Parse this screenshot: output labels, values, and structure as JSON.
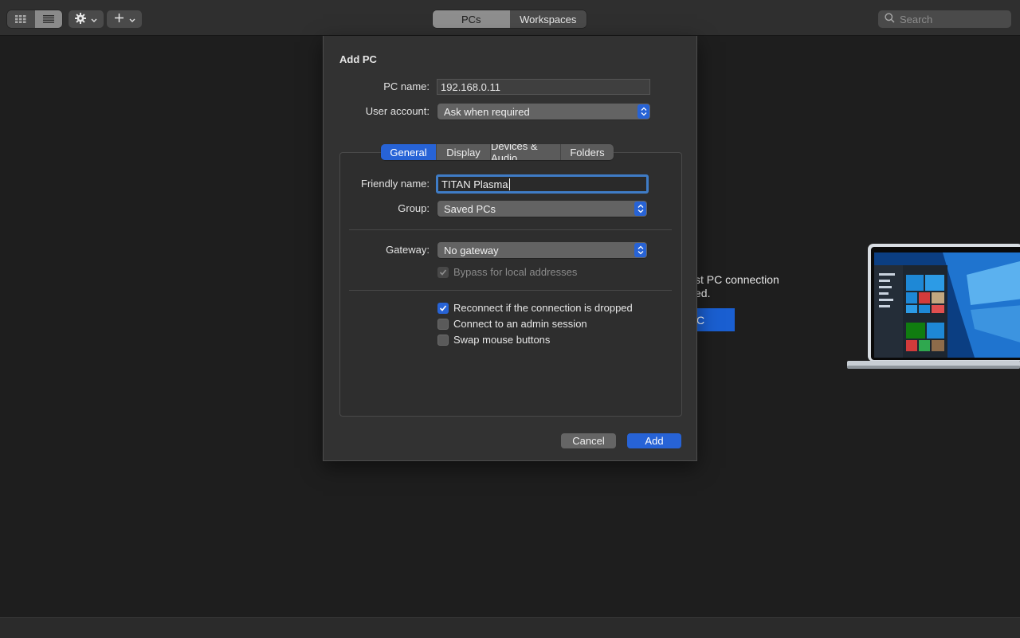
{
  "toolbar": {
    "view_buttons": [
      {
        "icon": "grid-icon",
        "selected": false
      },
      {
        "icon": "list-icon",
        "selected": true
      }
    ],
    "settings_icon": "gear-icon",
    "add_icon": "plus-icon",
    "segments": [
      {
        "label": "PCs",
        "selected": true
      },
      {
        "label": "Workspaces",
        "selected": false
      }
    ],
    "search_placeholder": "Search"
  },
  "background": {
    "empty_line1": "st PC connection",
    "empty_line2": "ed.",
    "empty_button": "C"
  },
  "dialog": {
    "title": "Add PC",
    "pc_name_label": "PC name:",
    "pc_name_value": "192.168.0.11",
    "user_account_label": "User account:",
    "user_account_value": "Ask when required",
    "tabs": [
      {
        "label": "General",
        "selected": true
      },
      {
        "label": "Display",
        "selected": false
      },
      {
        "label": "Devices & Audio",
        "selected": false
      },
      {
        "label": "Folders",
        "selected": false
      }
    ],
    "friendly_name_label": "Friendly name:",
    "friendly_name_value": "TITAN Plasma",
    "group_label": "Group:",
    "group_value": "Saved PCs",
    "gateway_label": "Gateway:",
    "gateway_value": "No gateway",
    "bypass_label": "Bypass for local addresses",
    "bypass_checked": true,
    "reconnect_label": "Reconnect if the connection is dropped",
    "reconnect_checked": true,
    "admin_label": "Connect to an admin session",
    "admin_checked": false,
    "swap_label": "Swap mouse buttons",
    "swap_checked": false,
    "cancel_label": "Cancel",
    "add_label": "Add"
  },
  "colors": {
    "accent": "#2763d6",
    "focus_ring": "#3f7cc6",
    "background": "#1e1e1e",
    "dialog": "#323232"
  }
}
